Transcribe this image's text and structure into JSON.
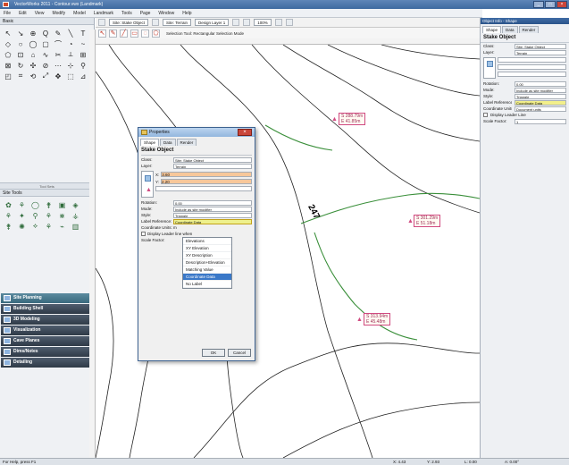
{
  "window": {
    "title": "VectorWorks 2011 - Contour.vwx (Landmark)",
    "controls": [
      "_",
      "□",
      "×"
    ]
  },
  "menubar": [
    "File",
    "Edit",
    "View",
    "Modify",
    "Model",
    "Landmark",
    "Tools",
    "Page",
    "Window",
    "Help"
  ],
  "toolbar": {
    "class_dropdown": "Site: Stake Object",
    "layer_dropdown": "Site: Terrain",
    "view_dropdown": "Design Layer 1",
    "zoom": "100%",
    "mode_label": "Selection Tool: Rectangular Selection Mode"
  },
  "left_panel": {
    "basic_header": "Basic",
    "tools_title": "Tool Sets",
    "tool_icons": [
      "↖",
      "↘",
      "⊕",
      "Q",
      "✎",
      "╲",
      "T",
      "◇",
      "○",
      "◯",
      "▢",
      "⌒",
      "◔",
      "~",
      "⬠",
      "⊡",
      "⌂",
      "∿",
      "✂",
      "⟂",
      "⊞",
      "⊠",
      "↻",
      "✣",
      "⊘",
      "⋯",
      "⊹",
      "⚲",
      "◰",
      "⌗",
      "⟲",
      "⤢",
      "✥",
      "⬚",
      "⊿"
    ],
    "site_header": "Site Tools",
    "site_icons": [
      "✿",
      "⚘",
      "◯",
      "⚵",
      "▣",
      "◈",
      "⚘",
      "✦",
      "⚲",
      "⚘",
      "⋇",
      "⚶",
      "⚵",
      "✺",
      "⟡",
      "⚘",
      "⌁",
      "▥"
    ],
    "palettes": [
      {
        "label": "Site Planning",
        "active": true
      },
      {
        "label": "Building Shell",
        "active": false
      },
      {
        "label": "3D Modeling",
        "active": false
      },
      {
        "label": "Visualization",
        "active": false
      },
      {
        "label": "Cave Planes",
        "active": false
      },
      {
        "label": "Dims/Notes",
        "active": false
      },
      {
        "label": "Detailing",
        "active": false
      }
    ]
  },
  "canvas": {
    "elevation_label": "247",
    "stakes": [
      {
        "line1": "S 288.79m",
        "line2": "E 41.85m"
      },
      {
        "line1": "S 301.29m",
        "line2": "E 51.18m"
      },
      {
        "line1": "S 313.94m",
        "line2": "E 45.48m"
      }
    ]
  },
  "properties_dialog": {
    "title": "Properties",
    "tabs": [
      "Shape",
      "Data",
      "Render"
    ],
    "header": "Stake Object",
    "class": {
      "label": "Class:",
      "value": "Site: Stake Object"
    },
    "layer": {
      "label": "Layer:",
      "value": "Terrain"
    },
    "x_label": "X:",
    "x_value": "3.60",
    "y_label": "Y:",
    "y_value": "2.20",
    "rotation": {
      "label": "Rotation:",
      "value": "0.00"
    },
    "mode": {
      "label": "Mode:",
      "value": "Include as site modifier"
    },
    "style": {
      "label": "Style:",
      "value": "Triangle"
    },
    "label_reference": {
      "label": "Label Reference:",
      "value": "Coordinate Data"
    },
    "coordinate_units": {
      "label": "Coordinate Units:",
      "value": "m"
    },
    "display_leader": "Display Leader line when",
    "scale_factor_label": "Scale Factor:",
    "options": [
      "Elevations",
      "XY Elevation",
      "XY Description",
      "Description+Elevation",
      "Matching Value",
      "Coordinate Data",
      "No Label"
    ],
    "selected_option": "Coordinate Data",
    "ok": "OK",
    "cancel": "Cancel"
  },
  "right_panel": {
    "title": "Object Info - Shape",
    "tabs": [
      "Shape",
      "Data",
      "Render"
    ],
    "header": "Stake Object",
    "class": {
      "label": "Class:",
      "value": "Site: Stake Object"
    },
    "layer": {
      "label": "Layer:",
      "value": "Terrain"
    },
    "rotation": {
      "label": "Rotation:",
      "value": "0.00"
    },
    "mode": {
      "label": "Mode:",
      "value": "Include as site modifier"
    },
    "style": {
      "label": "Style:",
      "value": "Triangle"
    },
    "label_reference": {
      "label": "Label Reference:",
      "value": "Coordinate Data"
    },
    "coordinate_units": {
      "label": "Coordinate Units:",
      "value": "Document units"
    },
    "display_leader": "Display Leader Line",
    "scale_factor": {
      "label": "Scale Factor:",
      "value": "1"
    }
  },
  "statusbar": {
    "text": "For Help, press F1",
    "x": "X: 4.43",
    "y": "Y: 2.93",
    "length": "L: 0.00",
    "angle": "A: 0.00°"
  }
}
